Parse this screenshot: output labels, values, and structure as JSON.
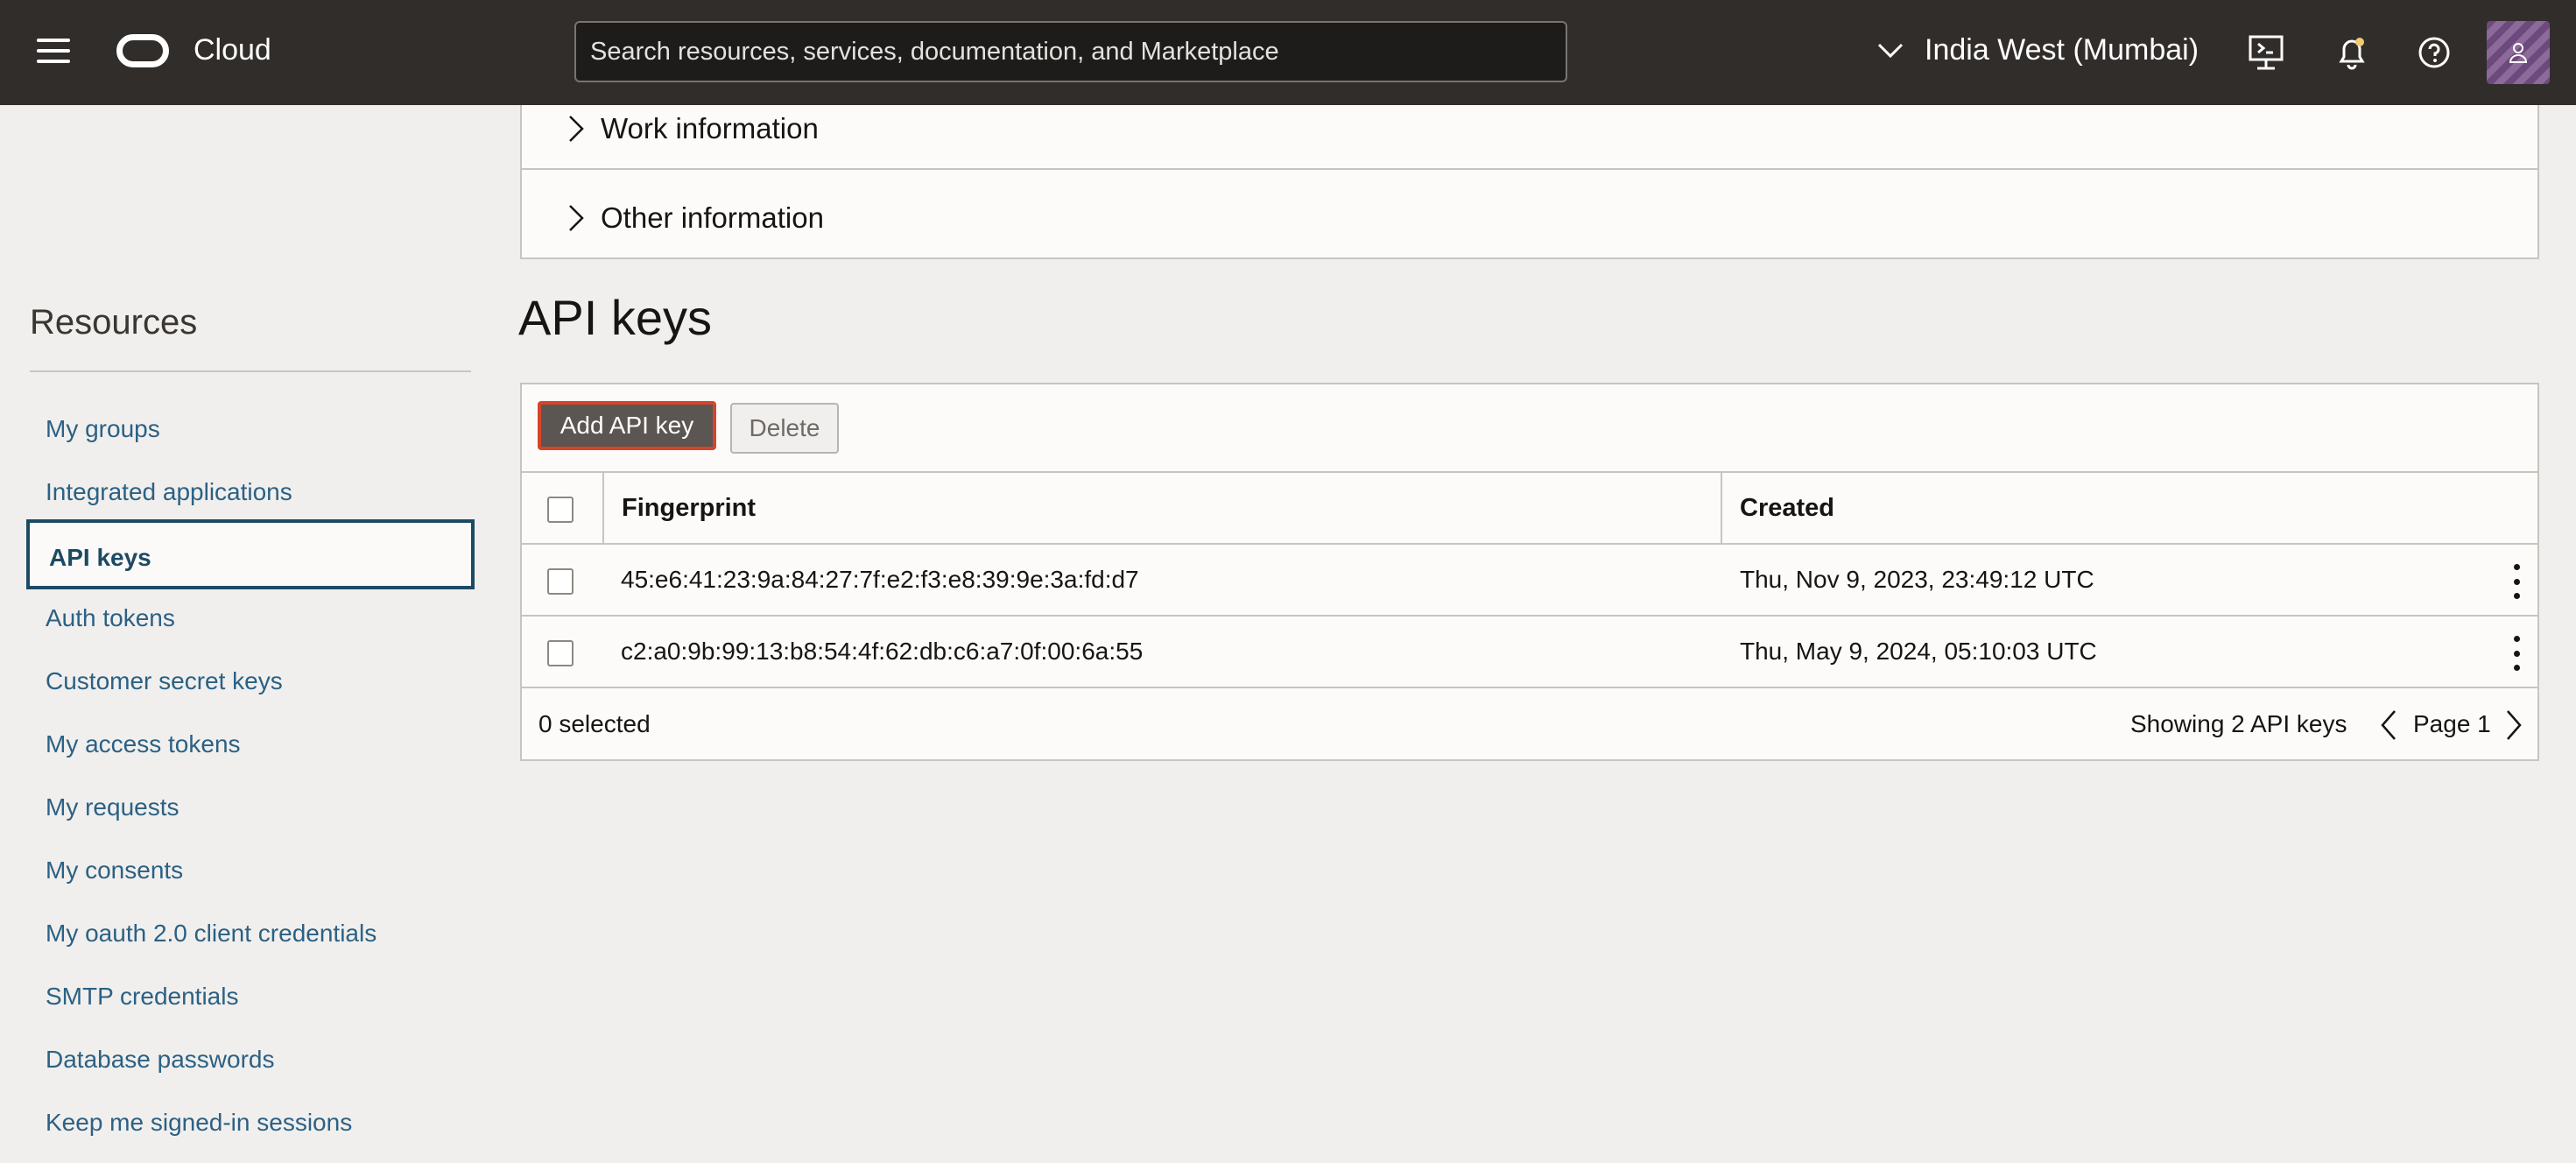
{
  "topbar": {
    "brand": "Cloud",
    "search_placeholder": "Search resources, services, documentation, and Marketplace",
    "region": "India West (Mumbai)"
  },
  "sections": {
    "work": "Work information",
    "other": "Other information"
  },
  "sidebar": {
    "title": "Resources",
    "items": [
      {
        "label": "My groups"
      },
      {
        "label": "Integrated applications"
      },
      {
        "label": "API keys",
        "active": true
      },
      {
        "label": "Auth tokens"
      },
      {
        "label": "Customer secret keys"
      },
      {
        "label": "My access tokens"
      },
      {
        "label": "My requests"
      },
      {
        "label": "My consents"
      },
      {
        "label": "My oauth 2.0 client credentials"
      },
      {
        "label": "SMTP credentials"
      },
      {
        "label": "Database passwords"
      },
      {
        "label": "Keep me signed-in sessions"
      }
    ]
  },
  "main": {
    "title": "API keys",
    "add_button": "Add API key",
    "delete_button": "Delete",
    "table": {
      "columns": [
        "Fingerprint",
        "Created"
      ],
      "rows": [
        {
          "fingerprint": "45:e6:41:23:9a:84:27:7f:e2:f3:e8:39:9e:3a:fd:d7",
          "created": "Thu, Nov 9, 2023, 23:49:12 UTC"
        },
        {
          "fingerprint": "c2:a0:9b:99:13:b8:54:4f:62:db:c6:a7:0f:00:6a:55",
          "created": "Thu, May 9, 2024, 05:10:03 UTC"
        }
      ]
    },
    "footer": {
      "selected": "0 selected",
      "showing": "Showing 2 API keys",
      "page": "Page 1"
    }
  },
  "colors": {
    "topbar": "#312d2a",
    "link": "#2b6184",
    "active_border": "#1d4a63",
    "primary_button": "#5b5651",
    "highlight_border": "#d6432c"
  }
}
